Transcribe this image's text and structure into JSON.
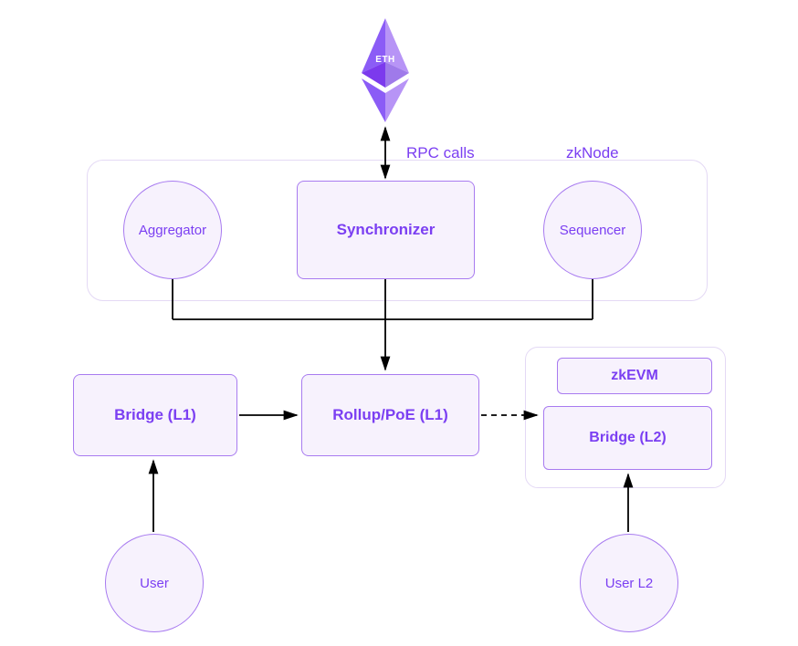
{
  "diagram": {
    "eth": {
      "label": "ETH"
    },
    "zknode": {
      "container_label": "zkNode",
      "rpc_label": "RPC calls",
      "aggregator": "Aggregator",
      "synchronizer": "Synchronizer",
      "sequencer": "Sequencer"
    },
    "bridge_l1": "Bridge (L1)",
    "rollup": "Rollup/PoE (L1)",
    "zkevm": {
      "container_label": "zkEVM",
      "bridge_l2": "Bridge (L2)"
    },
    "user": "User",
    "user_l2": "User L2"
  },
  "colors": {
    "purple": "#7b3ff2",
    "purple_light": "#a87bf0",
    "fill": "#f7f2fd",
    "grey_border": "#e4d9f5"
  }
}
